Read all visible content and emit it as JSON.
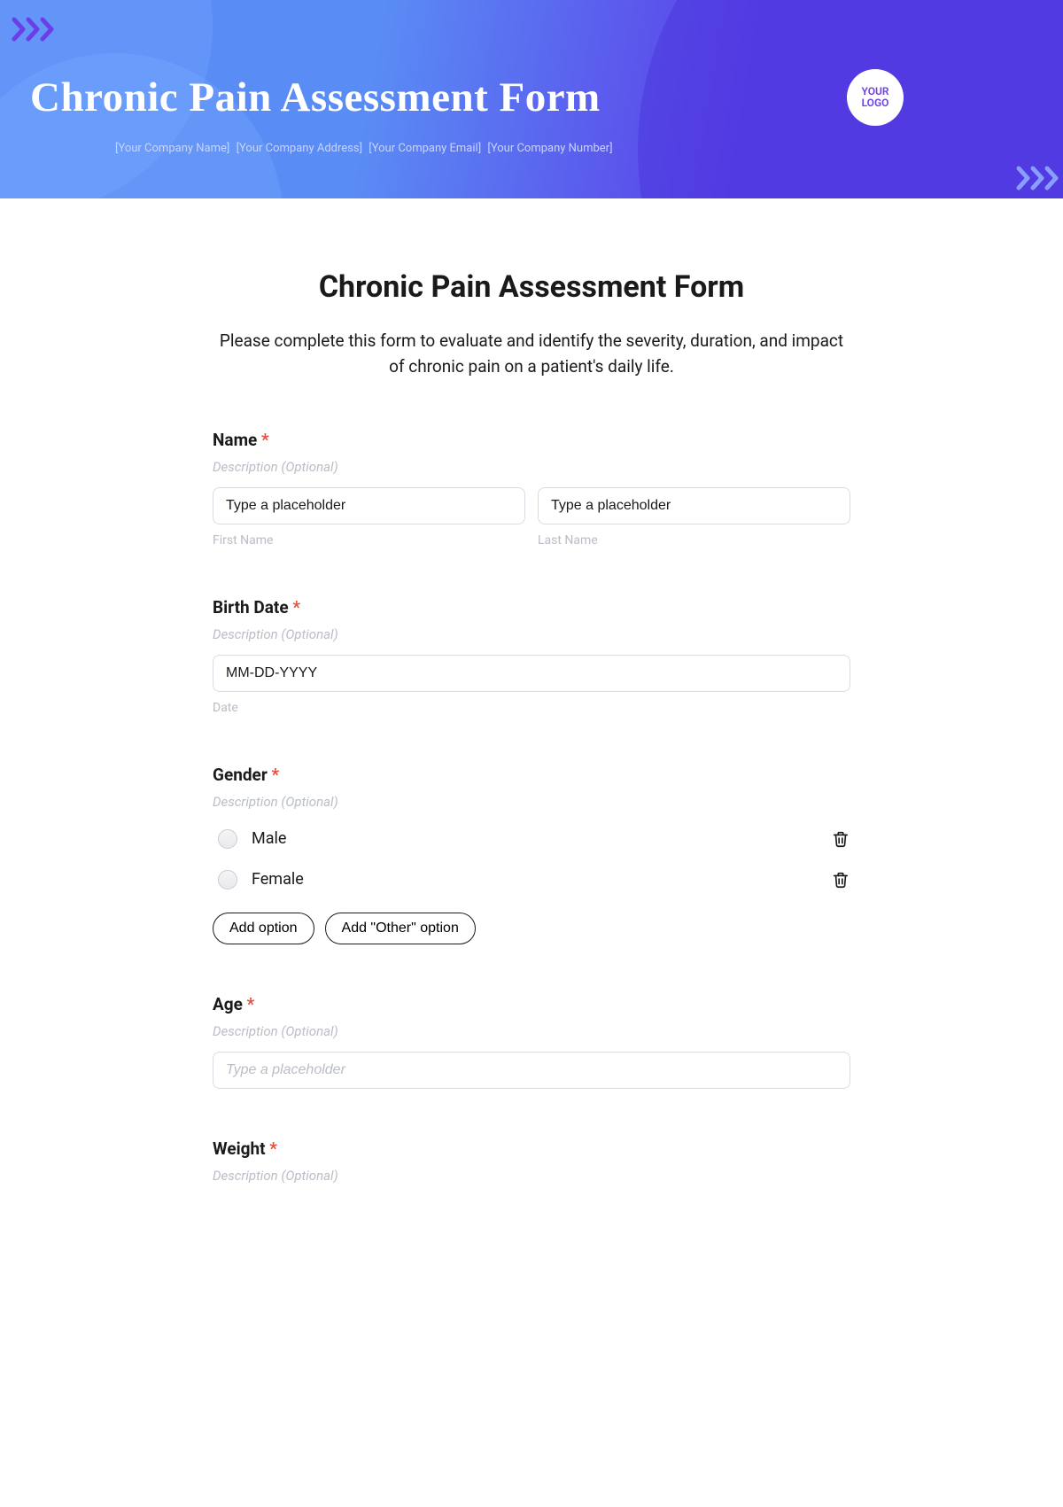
{
  "banner": {
    "title": "Chronic Pain Assessment Form",
    "logo": "YOUR LOGO",
    "meta": {
      "company": "[Your Company Name]",
      "address": "[Your Company Address]",
      "email": "[Your Company Email]",
      "number": "[Your Company Number]"
    }
  },
  "form": {
    "title": "Chronic Pain Assessment Form",
    "description": "Please complete this form to evaluate and identify the severity, duration, and impact of chronic pain on a patient's daily life.",
    "desc_optional": "Description (Optional)",
    "fields": {
      "name": {
        "label": "Name",
        "first_placeholder": "Type a placeholder",
        "last_placeholder": "Type a placeholder",
        "first_caption": "First Name",
        "last_caption": "Last Name"
      },
      "birthdate": {
        "label": "Birth Date",
        "placeholder": "MM-DD-YYYY",
        "caption": "Date"
      },
      "gender": {
        "label": "Gender",
        "options": [
          "Male",
          "Female"
        ],
        "add_option": "Add option",
        "add_other": "Add \"Other\" option"
      },
      "age": {
        "label": "Age",
        "placeholder": "Type a placeholder"
      },
      "weight": {
        "label": "Weight"
      }
    }
  }
}
